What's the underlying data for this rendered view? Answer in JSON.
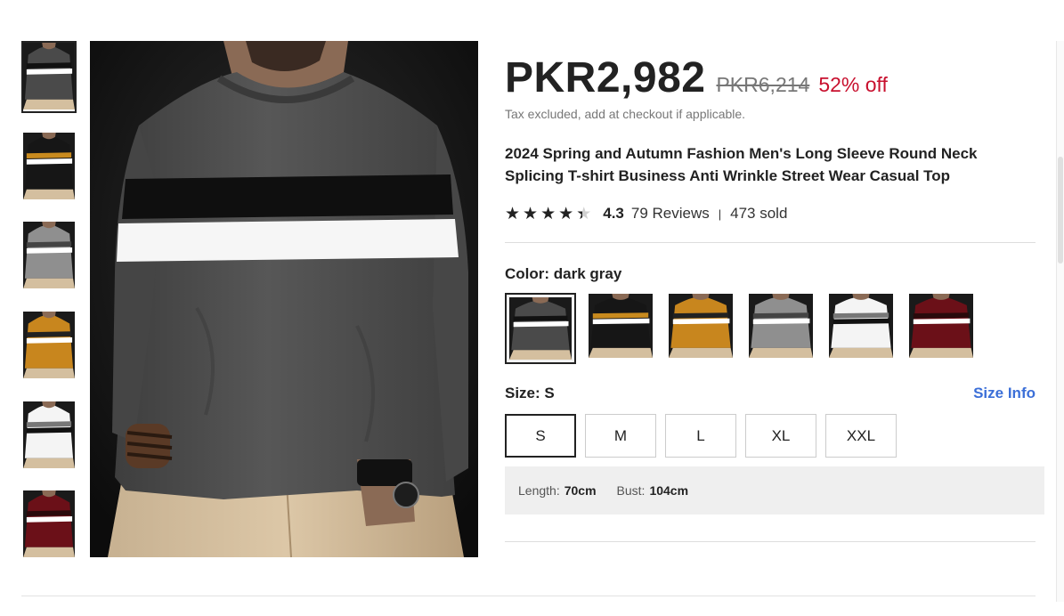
{
  "product": {
    "price": "PKR2,982",
    "original_price": "PKR6,214",
    "discount": "52% off",
    "tax_note": "Tax excluded, add at checkout if applicable.",
    "title": "2024 Spring and Autumn Fashion Men's Long Sleeve Round Neck Splicing T-shirt Business Anti Wrinkle Street Wear Casual Top",
    "rating": "4.3",
    "rating_value": 4.3,
    "reviews": "79 Reviews",
    "separator": "|",
    "sold": "473 sold"
  },
  "color": {
    "label": "Color:",
    "selected": "dark gray",
    "options": [
      {
        "name": "dark gray",
        "body": "#4a4a4a",
        "stripe1": "#111111",
        "stripe2": "#ffffff"
      },
      {
        "name": "black",
        "body": "#161616",
        "stripe1": "#c88a1e",
        "stripe2": "#ffffff"
      },
      {
        "name": "mustard",
        "body": "#c8861e",
        "stripe1": "#222222",
        "stripe2": "#ffffff"
      },
      {
        "name": "light gray",
        "body": "#8f8f8f",
        "stripe1": "#444444",
        "stripe2": "#ffffff"
      },
      {
        "name": "white",
        "body": "#f4f4f4",
        "stripe1": "#777777",
        "stripe2": "#111111"
      },
      {
        "name": "burgundy",
        "body": "#6b1018",
        "stripe1": "#2a0a0c",
        "stripe2": "#ffffff"
      }
    ]
  },
  "size": {
    "label": "Size:",
    "selected": "S",
    "info_link": "Size Info",
    "options": [
      "S",
      "M",
      "L",
      "XL",
      "XXL"
    ],
    "measurements": {
      "length_label": "Length:",
      "length_value": "70cm",
      "bust_label": "Bust:",
      "bust_value": "104cm"
    }
  },
  "thumbnails": [
    "dark gray",
    "black",
    "light gray",
    "mustard",
    "white",
    "burgundy"
  ],
  "colors": {
    "discount": "#c8102e",
    "link": "#3b6fd8",
    "measure_bg": "#efefef"
  }
}
